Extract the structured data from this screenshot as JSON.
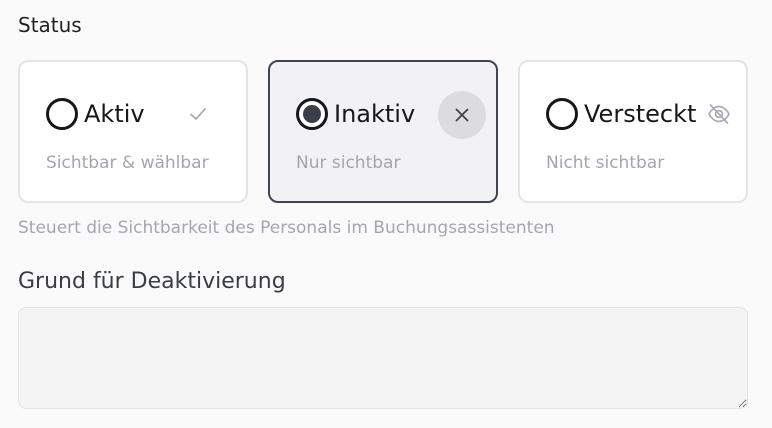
{
  "status": {
    "label": "Status",
    "helper": "Steuert die Sichtbarkeit des Personals im Buchungsassistenten",
    "selected": "inaktiv",
    "options": [
      {
        "key": "aktiv",
        "title": "Aktiv",
        "subtitle": "Sichtbar & wählbar",
        "icon": "check-icon"
      },
      {
        "key": "inaktiv",
        "title": "Inaktiv",
        "subtitle": "Nur sichtbar",
        "icon": "close-icon"
      },
      {
        "key": "versteckt",
        "title": "Versteckt",
        "subtitle": "Nicht sichtbar",
        "icon": "eye-off-icon"
      }
    ]
  },
  "reason": {
    "label": "Grund für Deaktivierung",
    "value": ""
  },
  "colors": {
    "selected_border": "#3f4651",
    "selected_background": "#f2f2f4",
    "muted_text": "#a3a6ae"
  }
}
